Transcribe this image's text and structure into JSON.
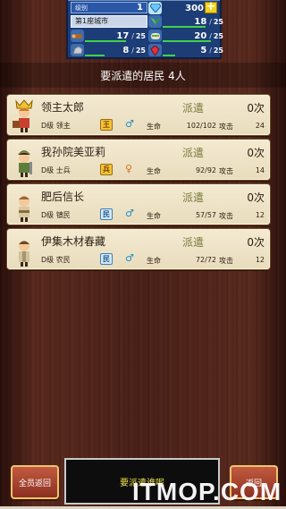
{
  "status": {
    "level_label": "级别",
    "level_value": "1",
    "gems": "300",
    "city": "第1座城市",
    "resources": [
      {
        "icon": "wood-icon",
        "value": "17",
        "max": "25",
        "fill": 0.68
      },
      {
        "icon": "herb-icon",
        "value": "18",
        "max": "25",
        "fill": 0.72
      },
      {
        "icon": "food-icon",
        "value": "20",
        "max": "25",
        "fill": 0.8
      },
      {
        "icon": "ore-icon",
        "value": "8",
        "max": "25",
        "fill": 0.32
      },
      {
        "icon": "gem-icon",
        "value": "5",
        "max": "25",
        "fill": 0.2
      }
    ]
  },
  "header": "要派遣的居民 4人",
  "residents": [
    {
      "name": "领主太郎",
      "rank": "D级 领主",
      "badge": "王",
      "badge_style": "gold",
      "gender": "♂",
      "gender_class": "male",
      "hp_label": "生命",
      "hp": "102/102",
      "atk_label": "攻击",
      "atk": "24",
      "dispatch": "派遣",
      "count": "0次"
    },
    {
      "name": "我孙院美亚莉",
      "rank": "D级 士兵",
      "badge": "兵",
      "badge_style": "gold",
      "gender": "♀",
      "gender_class": "female",
      "hp_label": "生命",
      "hp": "92/92",
      "atk_label": "攻击",
      "atk": "14",
      "dispatch": "派遣",
      "count": "0次"
    },
    {
      "name": "肥后信长",
      "rank": "D级 镇民",
      "badge": "民",
      "badge_style": "blue",
      "gender": "♂",
      "gender_class": "male",
      "hp_label": "生命",
      "hp": "57/57",
      "atk_label": "攻击",
      "atk": "12",
      "dispatch": "派遣",
      "count": "0次"
    },
    {
      "name": "伊集木材春藏",
      "rank": "D级 农民",
      "badge": "民",
      "badge_style": "blue",
      "gender": "♂",
      "gender_class": "male",
      "hp_label": "生命",
      "hp": "72/72",
      "atk_label": "攻击",
      "atk": "12",
      "dispatch": "派遣",
      "count": "0次"
    }
  ],
  "buttons": {
    "all_return": "全员返回",
    "back": "返回"
  },
  "message": "要派遣谁呢",
  "watermark": "ITMOP.COM",
  "colors": {
    "panel_blue": "#1d3d76",
    "card_bg": "#f3ead1",
    "button_red": "#a9412c",
    "message_yellow": "#f2e34a"
  }
}
